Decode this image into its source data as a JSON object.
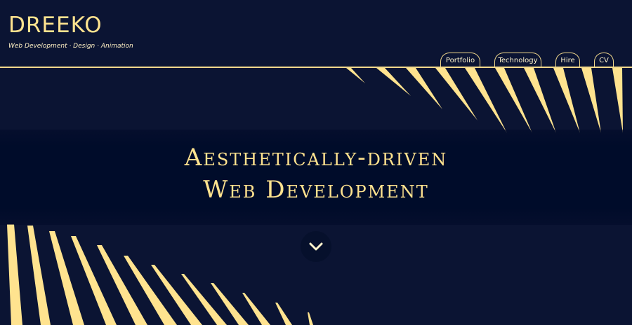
{
  "brand": {
    "logo": "DREEKO",
    "tagline": "Web Development · Design · Animation"
  },
  "nav": {
    "items": [
      {
        "label": "Portfolio"
      },
      {
        "label": "Technology"
      },
      {
        "label": "Hire"
      },
      {
        "label": "CV"
      }
    ]
  },
  "hero": {
    "line1": "Aesthetically-driven",
    "line2": "Web Development"
  },
  "icons": {
    "scroll": "chevron-down-icon"
  },
  "colors": {
    "background": "#0b1433",
    "accent": "#ffe38f",
    "band": "#000c2a"
  }
}
